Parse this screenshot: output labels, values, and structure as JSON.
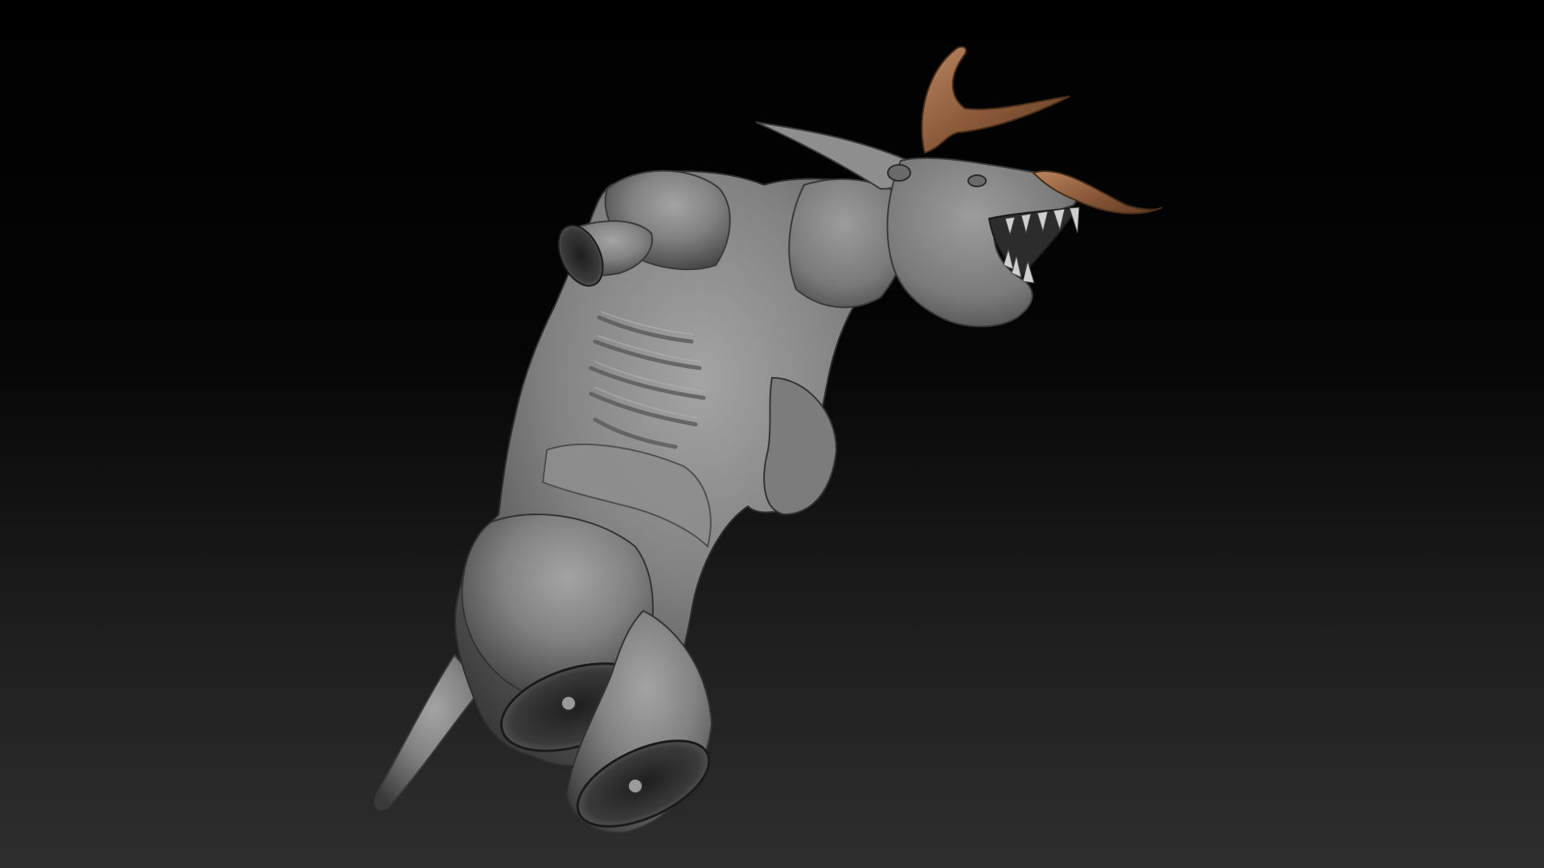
{
  "viewport": {
    "background_top_color": "#000000",
    "background_bottom_color": "#2e2e2e"
  },
  "model": {
    "material_color": "#8a8a8a",
    "shadow_color": "#3c3c3c",
    "highlight_color": "#c4c4c4",
    "horn_color": "#8b5a3a",
    "horn_highlight_color": "#b88460",
    "cut_color": "#2a2a2a"
  }
}
